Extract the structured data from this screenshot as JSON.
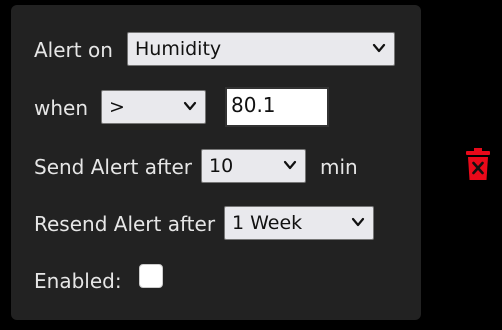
{
  "alert_on": {
    "label": "Alert on",
    "selected": "Humidity"
  },
  "when": {
    "label": "when",
    "operator": ">",
    "threshold": "80.1"
  },
  "send_after": {
    "label": "Send Alert after",
    "selected": "10",
    "unit": "min"
  },
  "resend_after": {
    "label": "Resend Alert after",
    "selected": "1 Week"
  },
  "enabled": {
    "label": "Enabled:",
    "checked": false
  },
  "icons": {
    "delete": "trash-icon",
    "dropdown": "chevron-down-icon"
  },
  "colors": {
    "delete": "#e8091a",
    "panel": "#222222"
  }
}
